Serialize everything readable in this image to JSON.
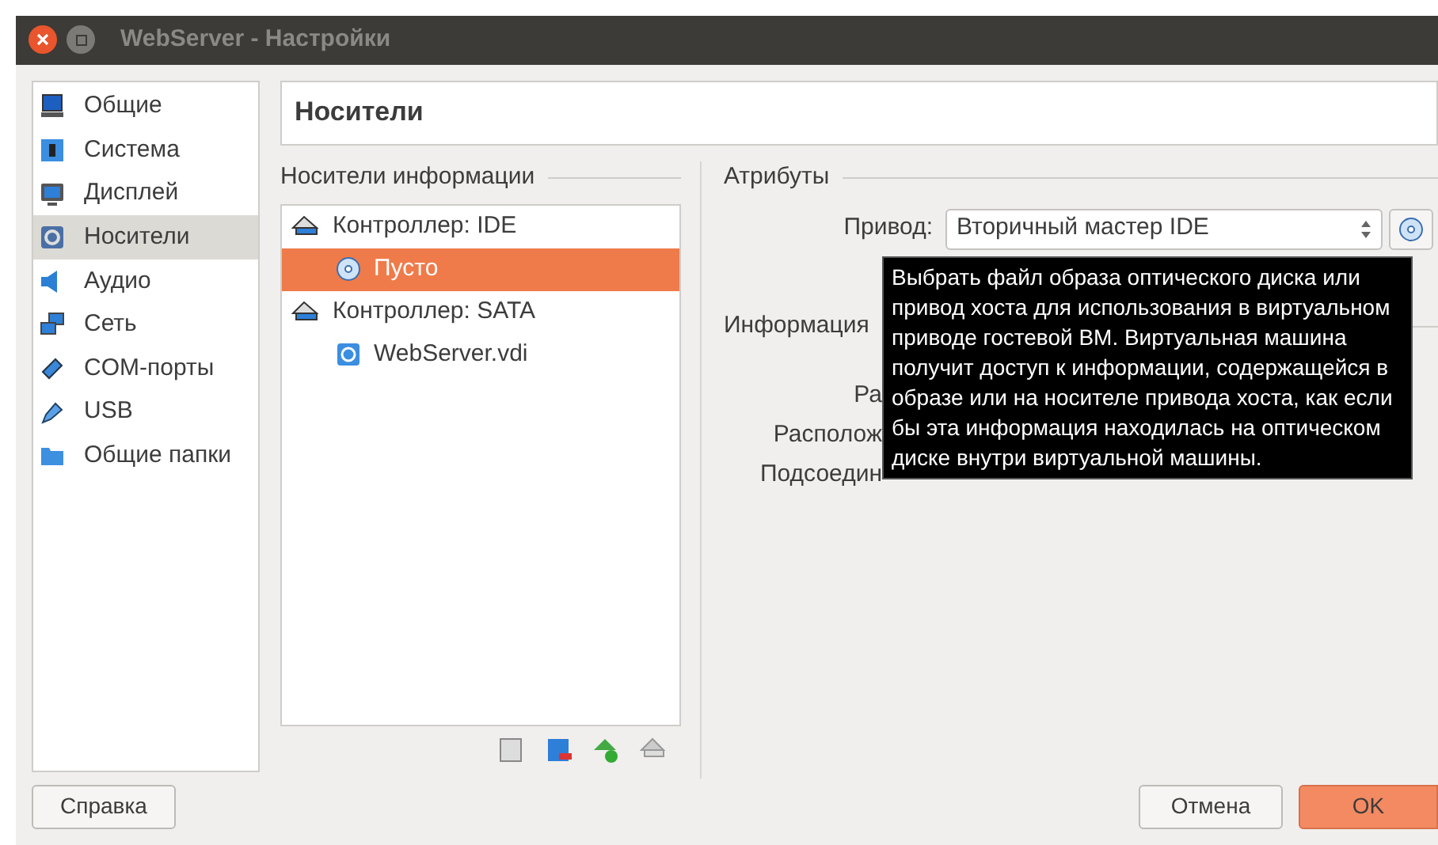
{
  "window": {
    "title": "WebServer - Настройки"
  },
  "sidebar": {
    "items": [
      {
        "label": "Общие",
        "kind": "monitor",
        "selected": false
      },
      {
        "label": "Система",
        "kind": "chip",
        "selected": false
      },
      {
        "label": "Дисплей",
        "kind": "display",
        "selected": false
      },
      {
        "label": "Носители",
        "kind": "disk",
        "selected": true
      },
      {
        "label": "Аудио",
        "kind": "speaker",
        "selected": false
      },
      {
        "label": "Сеть",
        "kind": "network",
        "selected": false
      },
      {
        "label": "COM-порты",
        "kind": "port",
        "selected": false
      },
      {
        "label": "USB",
        "kind": "usb",
        "selected": false
      },
      {
        "label": "Общие папки",
        "kind": "folder",
        "selected": false
      }
    ]
  },
  "page_title": "Носители",
  "storage": {
    "title": "Носители информации",
    "tree": [
      {
        "label": "Контроллер: IDE",
        "kind": "controller",
        "selected": false,
        "children": [
          {
            "label": "Пусто",
            "kind": "optical",
            "selected": true
          }
        ]
      },
      {
        "label": "Контроллер: SATA",
        "kind": "controller",
        "selected": false,
        "children": [
          {
            "label": "WebServer.vdi",
            "kind": "harddisk",
            "selected": false
          }
        ]
      }
    ]
  },
  "attributes": {
    "title": "Атрибуты",
    "drive_label": "Привод:",
    "drive_value": "Вторичный мастер IDE"
  },
  "information": {
    "title": "Информация",
    "labels": [
      "Ра",
      "Располож",
      "Подсоедин"
    ]
  },
  "tooltip": "Выбрать файл образа оптического диска или привод хоста для использования в виртуальном приводе гостевой ВМ. Виртуальная машина получит доступ к информации, содержащейся в образе или на носителе привода хоста, как если бы эта информация находилась на оптическом диске внутри виртуальной машины.",
  "buttons": {
    "help": "Справка",
    "cancel": "Отмена",
    "ok": "OK"
  }
}
